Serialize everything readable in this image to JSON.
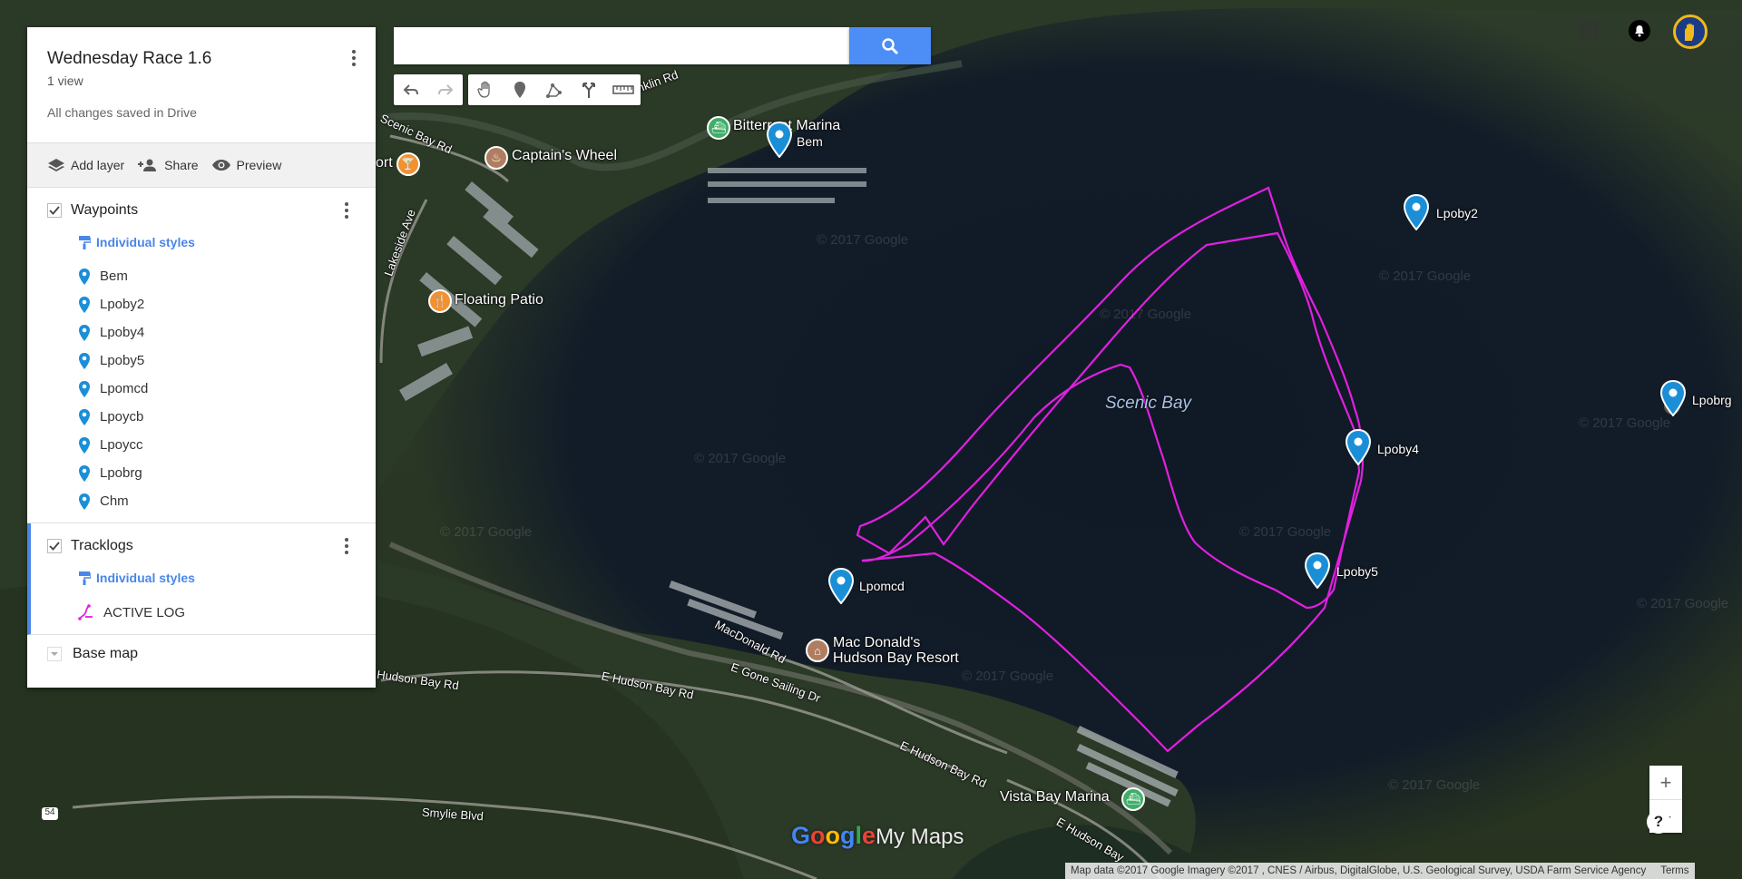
{
  "map": {
    "places": {
      "marina": "Bitterroot Marina",
      "captains_wheel": "Captain's Wheel",
      "floating_patio": "Floating Patio",
      "macdonalds": "Mac Donald's",
      "macdonalds_line2": "Hudson Bay Resort",
      "vista_bay_marina": "Vista Bay Marina",
      "port": "ort",
      "scenic_bay": "Scenic Bay"
    },
    "roads": {
      "scenic_bay_rd": "Scenic Bay Rd",
      "lakeside_ave": "Lakeside Ave",
      "hudson_bay_rd": "Hudson Bay Rd",
      "e_hudson_bay_rd": "E Hudson Bay Rd",
      "e_hudson_bay_rd_2": "E Hudson Bay Rd",
      "macdonald_rd": "MacDonald Rd",
      "e_gone_sailing_dr": "E Gone Sailing Dr",
      "smylie_blvd": "Smylie Blvd",
      "franklin_rd": "ranklin Rd",
      "e_hudson_bay_rd_3": "E Hudson Bay",
      "route": "54"
    },
    "watermark": "© 2017 Google",
    "pins": {
      "bem": "Bem",
      "lpoby2": "Lpoby2",
      "lpoby4": "Lpoby4",
      "lpoby5": "Lpoby5",
      "lpomcd": "Lpomcd",
      "lpobrg": "Lpobrg"
    },
    "track_color": "#e020e0",
    "pin_color": "#1a8fd8"
  },
  "search": {
    "placeholder": "",
    "value": ""
  },
  "panel": {
    "title": "Wednesday Race 1.6",
    "views": "1 view",
    "saved": "All changes saved in Drive",
    "actions": {
      "add_layer": "Add layer",
      "share": "Share",
      "preview": "Preview"
    },
    "waypoints": {
      "title": "Waypoints",
      "styles": "Individual styles",
      "items": [
        "Bem",
        "Lpoby2",
        "Lpoby4",
        "Lpoby5",
        "Lpomcd",
        "Lpoycb",
        "Lpoycc",
        "Lpobrg",
        "Chm"
      ]
    },
    "tracklogs": {
      "title": "Tracklogs",
      "styles": "Individual styles",
      "items": [
        "ACTIVE LOG"
      ]
    },
    "basemap": "Base map"
  },
  "zoom": {
    "in": "+",
    "out": "−"
  },
  "help": "?",
  "logo": {
    "g": "Google",
    "rest": "My Maps"
  },
  "attribution": {
    "text": "Map data ©2017 Google Imagery ©2017 , CNES / Airbus, DigitalGlobe, U.S. Geological Survey, USDA Farm Service Agency",
    "terms": "Terms"
  }
}
